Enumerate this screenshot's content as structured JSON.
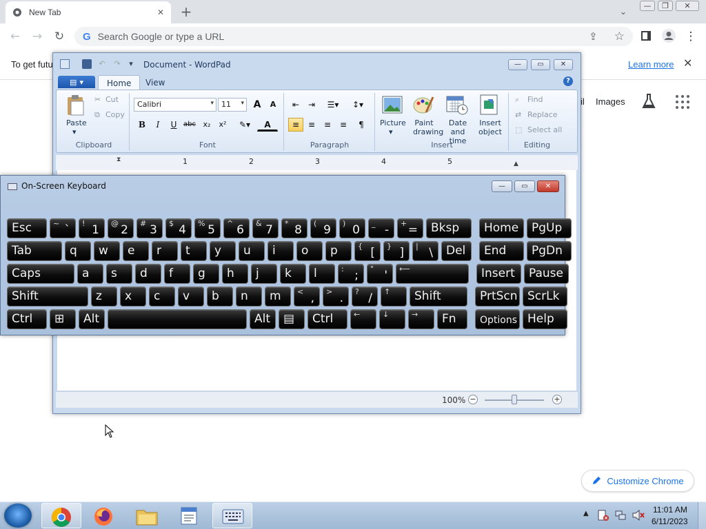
{
  "chrome": {
    "tab_title": "New Tab",
    "tab_close": "✕",
    "new_tab": "+",
    "tab_search": "⌄",
    "address_placeholder": "Search Google or type a URL",
    "google_mark": "G",
    "info_bar_text": "To get future",
    "learn_more": "Learn more",
    "info_close": "✕",
    "gmail_partial": "il",
    "images_link": "Images",
    "customize_label": "Customize Chrome",
    "back": "←",
    "forward": "→",
    "reload": "↻",
    "share": "⇪",
    "star": "☆",
    "menu": "⋮",
    "win_min": "—",
    "win_max": "❐",
    "win_close": "✕"
  },
  "wordpad": {
    "title": "Document - WordPad",
    "tabs": [
      "Home",
      "View"
    ],
    "clipboard": {
      "paste": "Paste",
      "cut": "Cut",
      "copy": "Copy",
      "label": "Clipboard"
    },
    "font": {
      "name": "Calibri",
      "size": "11",
      "grow": "A",
      "shrink": "A",
      "bold": "B",
      "italic": "I",
      "underline": "U",
      "strike": "abc",
      "sub": "x₂",
      "sup": "x²",
      "color": "A",
      "label": "Font"
    },
    "paragraph": {
      "label": "Paragraph"
    },
    "insert": {
      "picture": "Picture",
      "paint": "Paint drawing",
      "datetime": "Date and time",
      "object": "Insert object",
      "label": "Insert"
    },
    "editing": {
      "find": "Find",
      "replace": "Replace",
      "select_all": "Select all",
      "label": "Editing"
    },
    "ruler": [
      "1",
      "2",
      "3",
      "4",
      "5"
    ],
    "zoom": "100%",
    "zoom_level": 0.5,
    "zoom_out": "−",
    "zoom_in": "+",
    "help": "?",
    "win_min": "—",
    "win_max": "▭",
    "win_close": "✕"
  },
  "osk": {
    "title": "On-Screen Keyboard",
    "win_min": "—",
    "win_max": "▭",
    "win_close": "✕",
    "rows": [
      [
        {
          "m": "Esc",
          "w": 58
        },
        {
          "s": "~",
          "b": "`",
          "w": 38
        },
        {
          "s": "!",
          "b": "1",
          "w": 38
        },
        {
          "s": "@",
          "b": "2",
          "w": 38
        },
        {
          "s": "#",
          "b": "3",
          "w": 38
        },
        {
          "s": "$",
          "b": "4",
          "w": 38
        },
        {
          "s": "%",
          "b": "5",
          "w": 38
        },
        {
          "s": "^",
          "b": "6",
          "w": 38
        },
        {
          "s": "&",
          "b": "7",
          "w": 38
        },
        {
          "s": "*",
          "b": "8",
          "w": 38
        },
        {
          "s": "(",
          "b": "9",
          "w": 38
        },
        {
          "s": ")",
          "b": "0",
          "w": 38
        },
        {
          "s": "_",
          "b": "-",
          "w": 38
        },
        {
          "s": "+",
          "b": "=",
          "w": 38
        },
        {
          "m": "Bksp",
          "w": 66,
          "gap": 0
        },
        {
          "m": "Home",
          "w": 65,
          "gap": 7
        },
        {
          "m": "PgUp",
          "w": 65
        }
      ],
      [
        {
          "m": "Tab",
          "w": 80
        },
        {
          "m": "q",
          "w": 38
        },
        {
          "m": "w",
          "w": 38
        },
        {
          "m": "e",
          "w": 38
        },
        {
          "m": "r",
          "w": 38
        },
        {
          "m": "t",
          "w": 38
        },
        {
          "m": "y",
          "w": 38
        },
        {
          "m": "u",
          "w": 38
        },
        {
          "m": "i",
          "w": 38
        },
        {
          "m": "o",
          "w": 38
        },
        {
          "m": "p",
          "w": 38
        },
        {
          "s": "{",
          "b": "[",
          "w": 38
        },
        {
          "s": "}",
          "b": "]",
          "w": 38
        },
        {
          "s": "|",
          "b": "\\",
          "w": 38
        },
        {
          "m": "Del",
          "w": 44
        },
        {
          "m": "End",
          "w": 65,
          "gap": 7
        },
        {
          "m": "PgDn",
          "w": 65
        }
      ],
      [
        {
          "m": "Caps",
          "w": 98
        },
        {
          "m": "a",
          "w": 38
        },
        {
          "m": "s",
          "w": 38
        },
        {
          "m": "d",
          "w": 38
        },
        {
          "m": "f",
          "w": 38
        },
        {
          "m": "g",
          "w": 38
        },
        {
          "m": "h",
          "w": 38
        },
        {
          "m": "j",
          "w": 38
        },
        {
          "m": "k",
          "w": 38
        },
        {
          "m": "l",
          "w": 38
        },
        {
          "s": ":",
          "b": ";",
          "w": 38
        },
        {
          "s": "\"",
          "b": "'",
          "w": 38
        },
        {
          "s": "⟵",
          "w": 106
        },
        {
          "m": "Insert",
          "w": 65,
          "gap": 7
        },
        {
          "m": "Pause",
          "w": 65
        }
      ],
      [
        {
          "m": "Shift",
          "w": 118
        },
        {
          "m": "z",
          "w": 38
        },
        {
          "m": "x",
          "w": 38
        },
        {
          "m": "c",
          "w": 38
        },
        {
          "m": "v",
          "w": 38
        },
        {
          "m": "b",
          "w": 38
        },
        {
          "m": "n",
          "w": 38
        },
        {
          "m": "m",
          "w": 38
        },
        {
          "s": "<",
          "b": ",",
          "w": 38
        },
        {
          "s": ">",
          "b": ".",
          "w": 38
        },
        {
          "s": "?",
          "b": "/",
          "w": 38
        },
        {
          "s": "↑",
          "w": 38
        },
        {
          "m": "Shift",
          "w": 84
        },
        {
          "m": "PrtScn",
          "w": 65,
          "gap": 7
        },
        {
          "m": "ScrLk",
          "w": 65
        }
      ],
      [
        {
          "m": "Ctrl",
          "w": 58
        },
        {
          "m": "⊞",
          "w": 38
        },
        {
          "m": "Alt",
          "w": 38
        },
        {
          "m": "",
          "w": 202
        },
        {
          "m": "Alt",
          "w": 38
        },
        {
          "m": "▤",
          "w": 38
        },
        {
          "m": "Ctrl",
          "w": 58
        },
        {
          "s": "←",
          "w": 38
        },
        {
          "s": "↓",
          "w": 38
        },
        {
          "s": "→",
          "w": 38
        },
        {
          "m": "Fn",
          "w": 44
        },
        {
          "m": "Options",
          "w": 65,
          "gap": 7,
          "small": true
        },
        {
          "m": "Help",
          "w": 65
        }
      ]
    ]
  },
  "taskbar": {
    "clock_time": "11:01 AM",
    "clock_date": "6/11/2023",
    "tray_arrow": "▲"
  }
}
